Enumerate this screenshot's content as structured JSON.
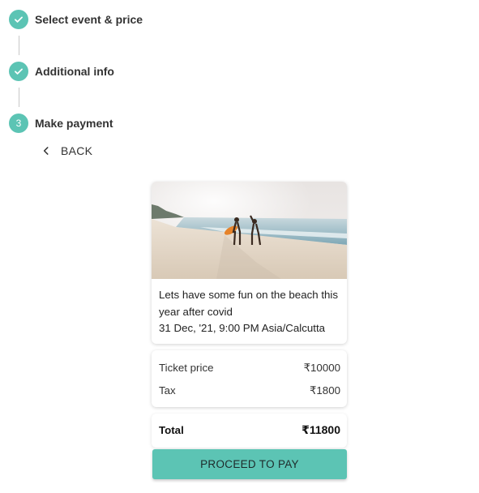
{
  "stepper": {
    "steps": [
      {
        "label": "Select event & price",
        "state": "completed"
      },
      {
        "label": "Additional info",
        "state": "completed"
      },
      {
        "label": "Make payment",
        "state": "active",
        "number": "3"
      }
    ]
  },
  "back": {
    "label": "BACK",
    "icon": "chevron-left-icon"
  },
  "event": {
    "image_icon": "beach-photo",
    "title": "Lets have some fun on the beach this year after covid",
    "datetime": "31 Dec, '21, 9:00 PM Asia/Calcutta"
  },
  "pricing": {
    "ticket_label": "Ticket price",
    "ticket_value": "₹10000",
    "tax_label": "Tax",
    "tax_value": "₹1800",
    "total_label": "Total",
    "total_value": "₹11800"
  },
  "actions": {
    "pay_label": "PROCEED TO PAY"
  },
  "colors": {
    "accent": "#5cc4b4"
  }
}
